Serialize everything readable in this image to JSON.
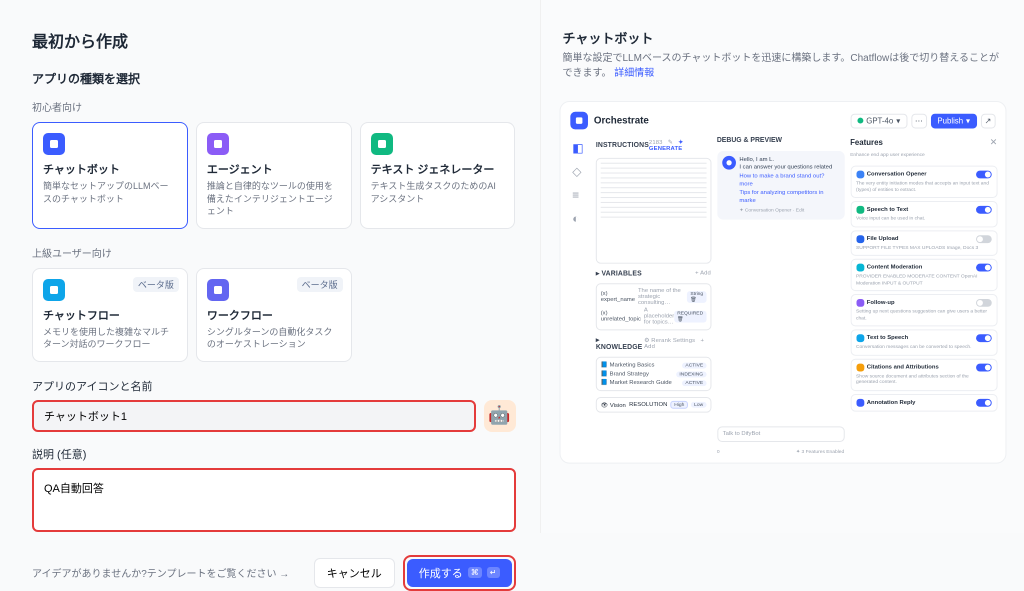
{
  "page": {
    "title": "最初から作成",
    "type_section_label": "アプリの種類を選択",
    "beginner_label": "初心者向け",
    "advanced_label": "上級ユーザー向け",
    "icon_name_label": "アプリのアイコンと名前",
    "description_label": "説明 (任意)",
    "template_prompt": "アイデアがありませんか?テンプレートをご覧ください",
    "cancel": "キャンセル",
    "create": "作成する",
    "create_shortcut_1": "⌘",
    "create_shortcut_2": "↵"
  },
  "types": [
    {
      "id": "chatbot",
      "title": "チャットボット",
      "desc": "簡単なセットアップのLLMベースのチャットボット",
      "color": "#3b5cff",
      "selected": true
    },
    {
      "id": "agent",
      "title": "エージェント",
      "desc": "推論と自律的なツールの使用を備えたインテリジェントエージェント",
      "color": "#8b5cf6",
      "selected": false
    },
    {
      "id": "textgen",
      "title": "テキスト ジェネレーター",
      "desc": "テキスト生成タスクのためのAIアシスタント",
      "color": "#10b981",
      "selected": false
    }
  ],
  "types_adv": [
    {
      "id": "chatflow",
      "title": "チャットフロー",
      "desc": "メモリを使用した複雑なマルチターン対話のワークフロー",
      "color": "#0ea5e9",
      "beta": "ベータ版"
    },
    {
      "id": "workflow",
      "title": "ワークフロー",
      "desc": "シングルターンの自動化タスクのオーケストレーション",
      "color": "#6366f1",
      "beta": "ベータ版"
    }
  ],
  "form": {
    "app_name_value": "チャットボット1",
    "desc_value": "QA自動回答"
  },
  "right": {
    "title": "チャットボット",
    "desc": "簡単な設定でLLMベースのチャットボットを迅速に構築します。Chatflowは後で切り替えることができます。",
    "detail_link": "詳細情報"
  },
  "preview": {
    "orchestrate": "Orchestrate",
    "model": "GPT-4o",
    "publish": "Publish",
    "instructions_label": "INSTRUCTIONS",
    "instr_meta": "2183",
    "generate": "GENERATE",
    "variables_label": "VARIABLES",
    "add": "+ Add",
    "vars": [
      {
        "name": "(x) expert_name",
        "hint": "The name of the strategic consulting…",
        "req": "String"
      },
      {
        "name": "(x) unrelated_topic",
        "hint": "A placeholder for topics…",
        "req": "REQUIRED"
      }
    ],
    "knowledge_label": "KNOWLEDGE",
    "rerank": "Rerank Settings",
    "knowledge": [
      {
        "name": "Marketing Basics",
        "status": "ACTIVE"
      },
      {
        "name": "Brand Strategy",
        "status": "INDEXING"
      },
      {
        "name": "Market Research Guide",
        "status": "ACTIVE"
      }
    ],
    "vision_label": "Vision",
    "resolution": "RESOLUTION",
    "res_high": "High",
    "res_low": "Low",
    "debug_title": "DEBUG & PREVIEW",
    "chat_greeting": "Hello, I am L.",
    "chat_line2": "I can answer your questions related",
    "chat_sugg1": "How to make a brand stand out?",
    "chat_sugg_more": "more",
    "chat_sugg2": "Tips for analyzing competitors in marke",
    "chat_opener": "Conversation Opener · Edit",
    "chat_input_placeholder": "Talk to DifyBot",
    "chat_footer_left": "0",
    "chat_footer_right": "3 Features Enabled",
    "features_title": "Features",
    "features_sub": "Enhance end app user experience",
    "features": [
      {
        "name": "Conversation Opener",
        "desc": "The very entity initiation modes that accepts an input text and (types) of entities to extract.",
        "color": "#3b82f6",
        "on": true
      },
      {
        "name": "Speech to Text",
        "desc": "Voice input can be used in chat.",
        "color": "#10b981",
        "on": true
      },
      {
        "name": "File Upload",
        "desc": "SUPPORT FILE TYPES  MAX UPLOADS\nImage, Docs          3",
        "color": "#2563eb",
        "on": false
      },
      {
        "name": "Content Moderation",
        "desc": "PROVIDER  ENABLED MODERATE CONTENT\nOpenAI Moderation  INPUT & OUTPUT",
        "color": "#06b6d4",
        "on": true
      },
      {
        "name": "Follow-up",
        "desc": "Setting up next questions suggestion can give users a better chat.",
        "color": "#8b5cf6",
        "on": false
      },
      {
        "name": "Text to Speech",
        "desc": "Conversation messages can be converted to speech.",
        "color": "#0ea5e9",
        "on": true
      },
      {
        "name": "Citations and Attributions",
        "desc": "Show source document and attributes section of the generated content.",
        "color": "#f59e0b",
        "on": true
      },
      {
        "name": "Annotation Reply",
        "desc": "",
        "color": "#3b5cff",
        "on": true
      }
    ]
  }
}
